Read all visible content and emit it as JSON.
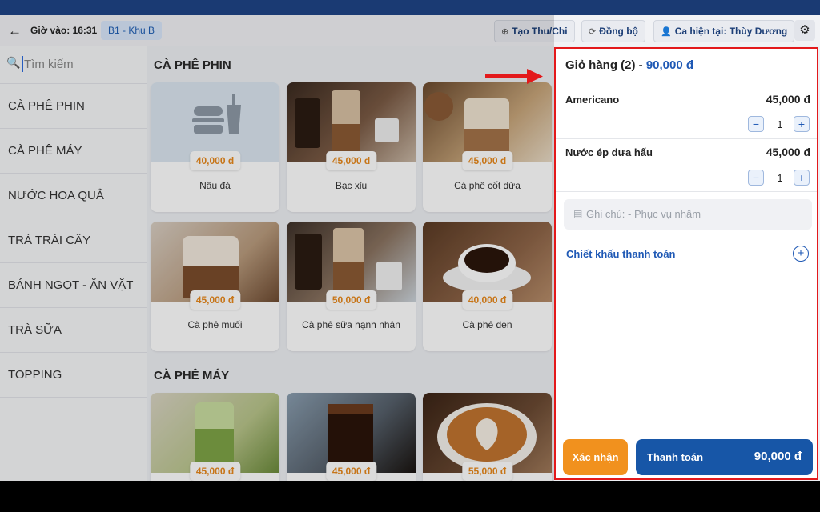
{
  "header": {
    "back_icon": "arrow-left-icon",
    "clock_in": "Giờ vào: 16:31",
    "table": "B1 - Khu B",
    "create_txn": "Tạo Thu/Chi",
    "sync": "Đồng bộ",
    "shift": "Ca hiện tại: Thùy Dương",
    "settings_icon": "gear-icon"
  },
  "sidebar": {
    "search_placeholder": "Tìm kiếm",
    "categories": [
      "CÀ PHÊ PHIN",
      "CÀ PHÊ MÁY",
      "NƯỚC HOA QUẢ",
      "TRÀ TRÁI CÂY",
      "BÁNH NGỌT - ĂN VẶT",
      "TRÀ SỮA",
      "TOPPING"
    ]
  },
  "sections": [
    {
      "title": "CÀ PHÊ PHIN",
      "products": [
        {
          "name": "Nâu đá",
          "price": "40,000 đ"
        },
        {
          "name": "Bạc xỉu",
          "price": "45,000 đ"
        },
        {
          "name": "Cà phê cốt dừa",
          "price": "45,000 đ"
        },
        {
          "name": "Cà phê muối",
          "price": "45,000 đ"
        },
        {
          "name": "Cà phê sữa hạnh nhân",
          "price": "50,000 đ"
        },
        {
          "name": "Cà phê đen",
          "price": "40,000 đ"
        }
      ]
    },
    {
      "title": "CÀ PHÊ MÁY",
      "products": [
        {
          "price": "45,000 đ"
        },
        {
          "price": "45,000 đ"
        },
        {
          "price": "55,000 đ"
        }
      ]
    }
  ],
  "cart": {
    "title": "Giỏ hàng (2) - ",
    "total": "90,000 đ",
    "items": [
      {
        "name": "Americano",
        "price": "45,000 đ",
        "qty": "1"
      },
      {
        "name": "Nước ép dưa hấu",
        "price": "45,000 đ",
        "qty": "1"
      }
    ],
    "note_placeholder": "Ghi chú:  - Phục vụ nhầm",
    "discount_label": "Chiết khấu thanh toán",
    "confirm_label": "Xác nhận",
    "pay_label": "Thanh toán",
    "pay_amount": "90,000 đ"
  },
  "colors": {
    "brand_blue": "#1756a7",
    "accent_orange": "#f1911e",
    "highlight_red": "#e3191b",
    "price_orange": "#e8891c"
  }
}
